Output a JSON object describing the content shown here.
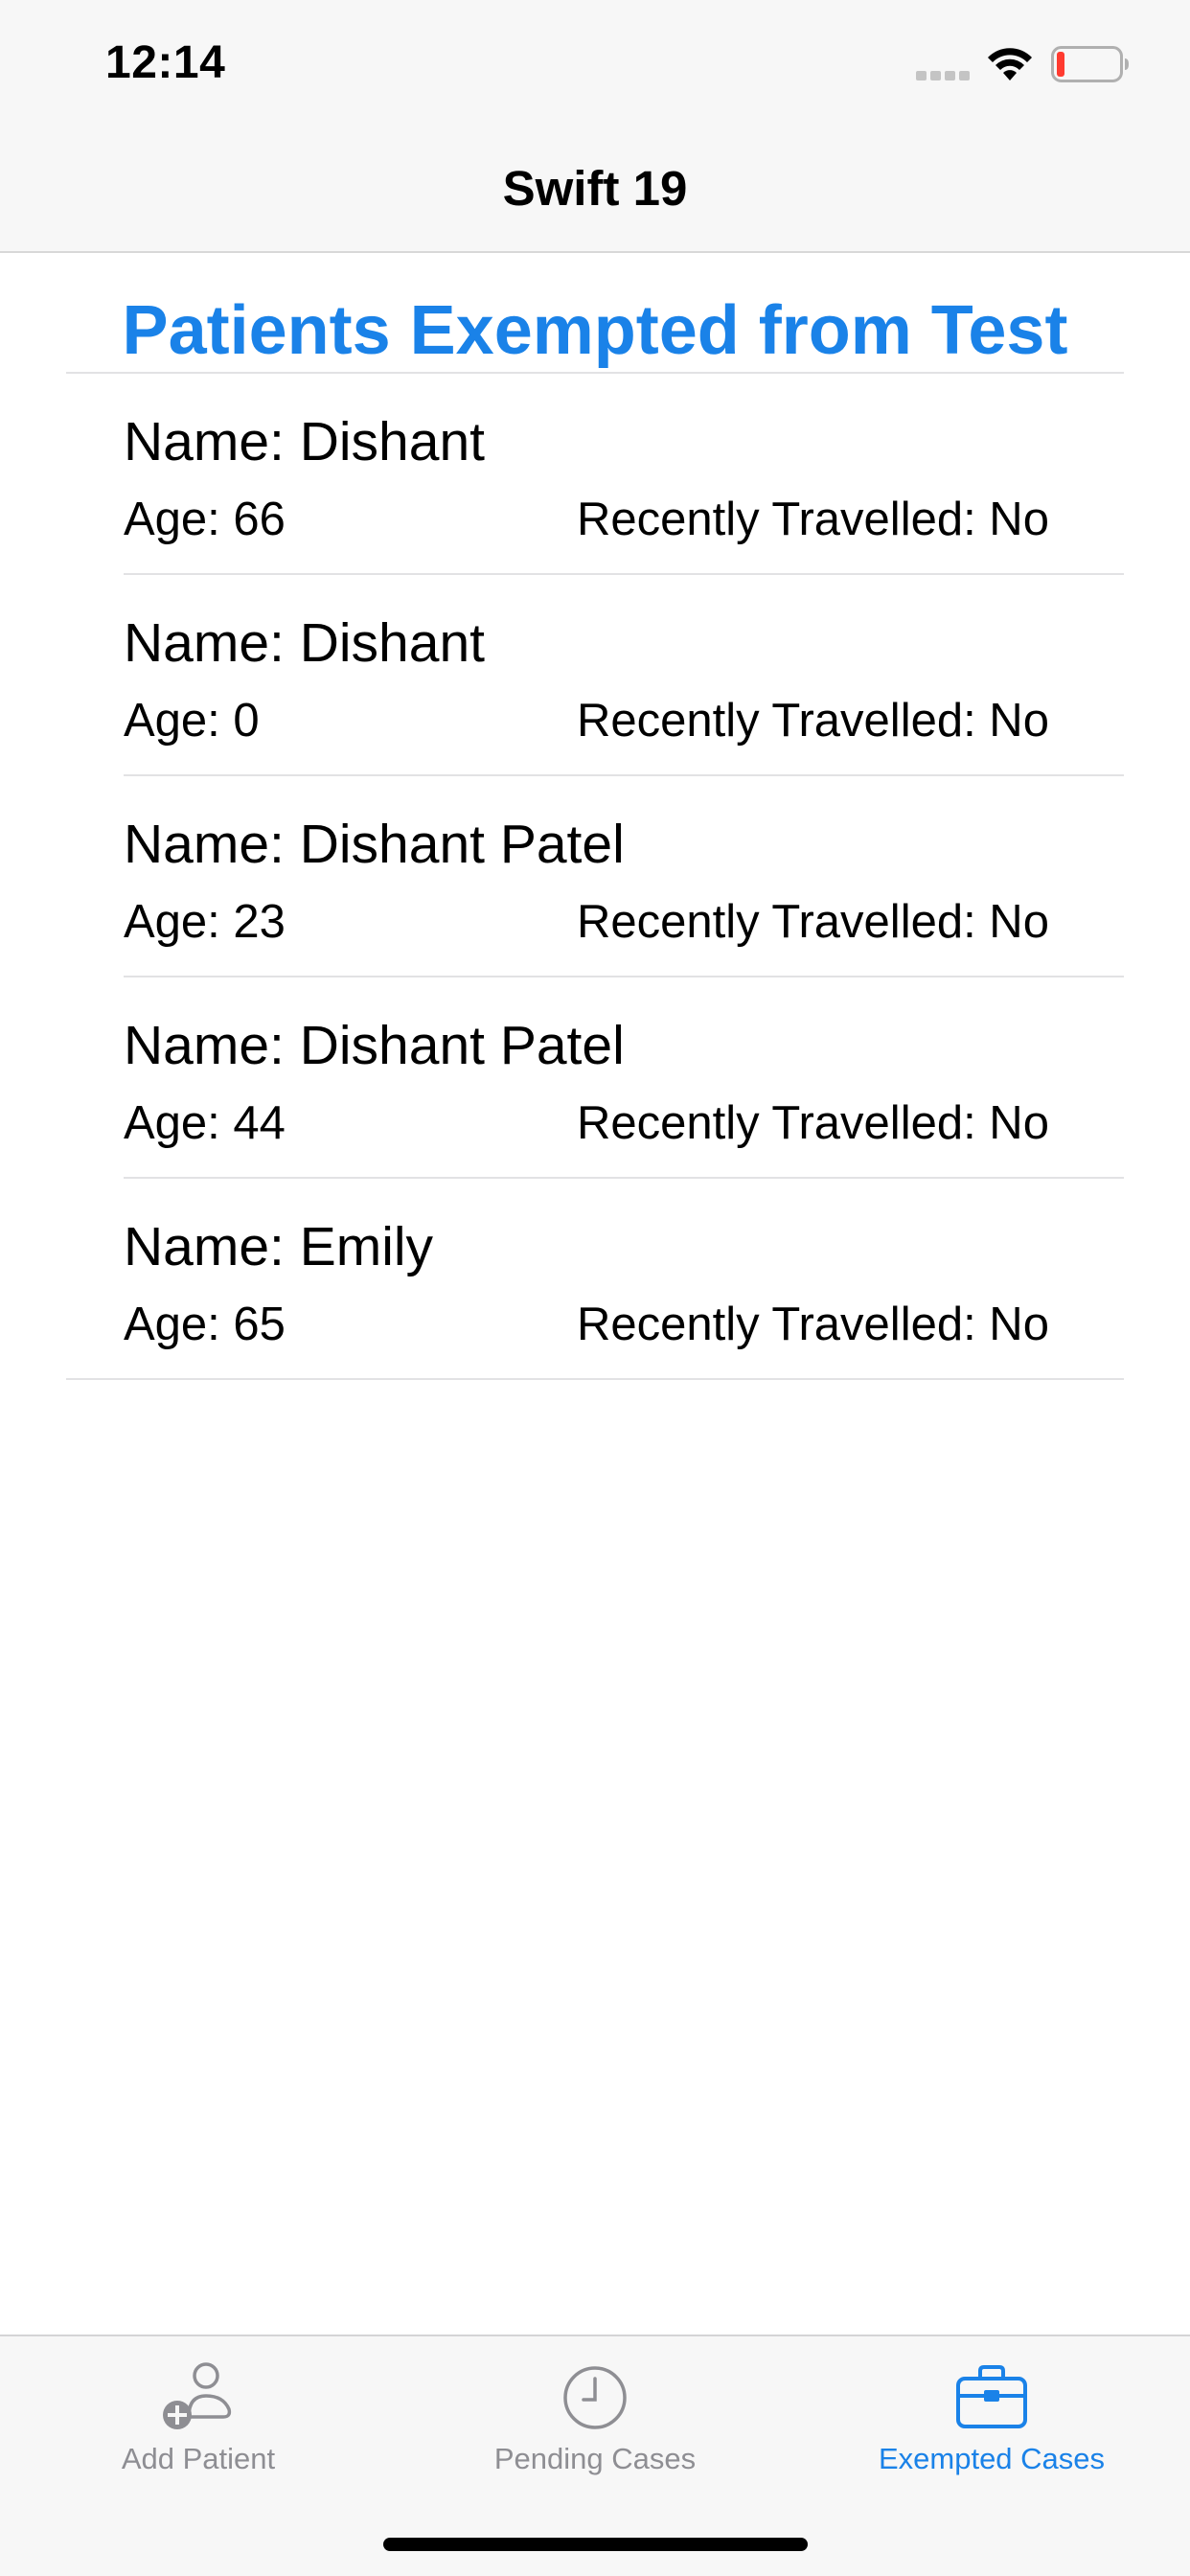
{
  "status_bar": {
    "time": "12:14"
  },
  "nav": {
    "title": "Swift 19"
  },
  "page": {
    "title": "Patients Exempted from Test"
  },
  "patients": [
    {
      "name": "Name: Dishant",
      "age": "Age: 66",
      "travelled": "Recently Travelled: No"
    },
    {
      "name": "Name: Dishant",
      "age": "Age: 0",
      "travelled": "Recently Travelled: No"
    },
    {
      "name": "Name: Dishant Patel",
      "age": "Age: 23",
      "travelled": "Recently Travelled: No"
    },
    {
      "name": "Name: Dishant Patel",
      "age": "Age: 44",
      "travelled": "Recently Travelled: No"
    },
    {
      "name": "Name: Emily",
      "age": "Age: 65",
      "travelled": "Recently Travelled: No"
    }
  ],
  "tabs": [
    {
      "label": "Add Patient",
      "icon": "add-person-icon",
      "active": false
    },
    {
      "label": "Pending Cases",
      "icon": "clock-icon",
      "active": false
    },
    {
      "label": "Exempted Cases",
      "icon": "briefcase-icon",
      "active": true
    }
  ],
  "colors": {
    "accent": "#1a82e8",
    "inactive": "#8e8e93",
    "bar_background": "#f7f7f7",
    "battery_low": "#ff3b30"
  }
}
